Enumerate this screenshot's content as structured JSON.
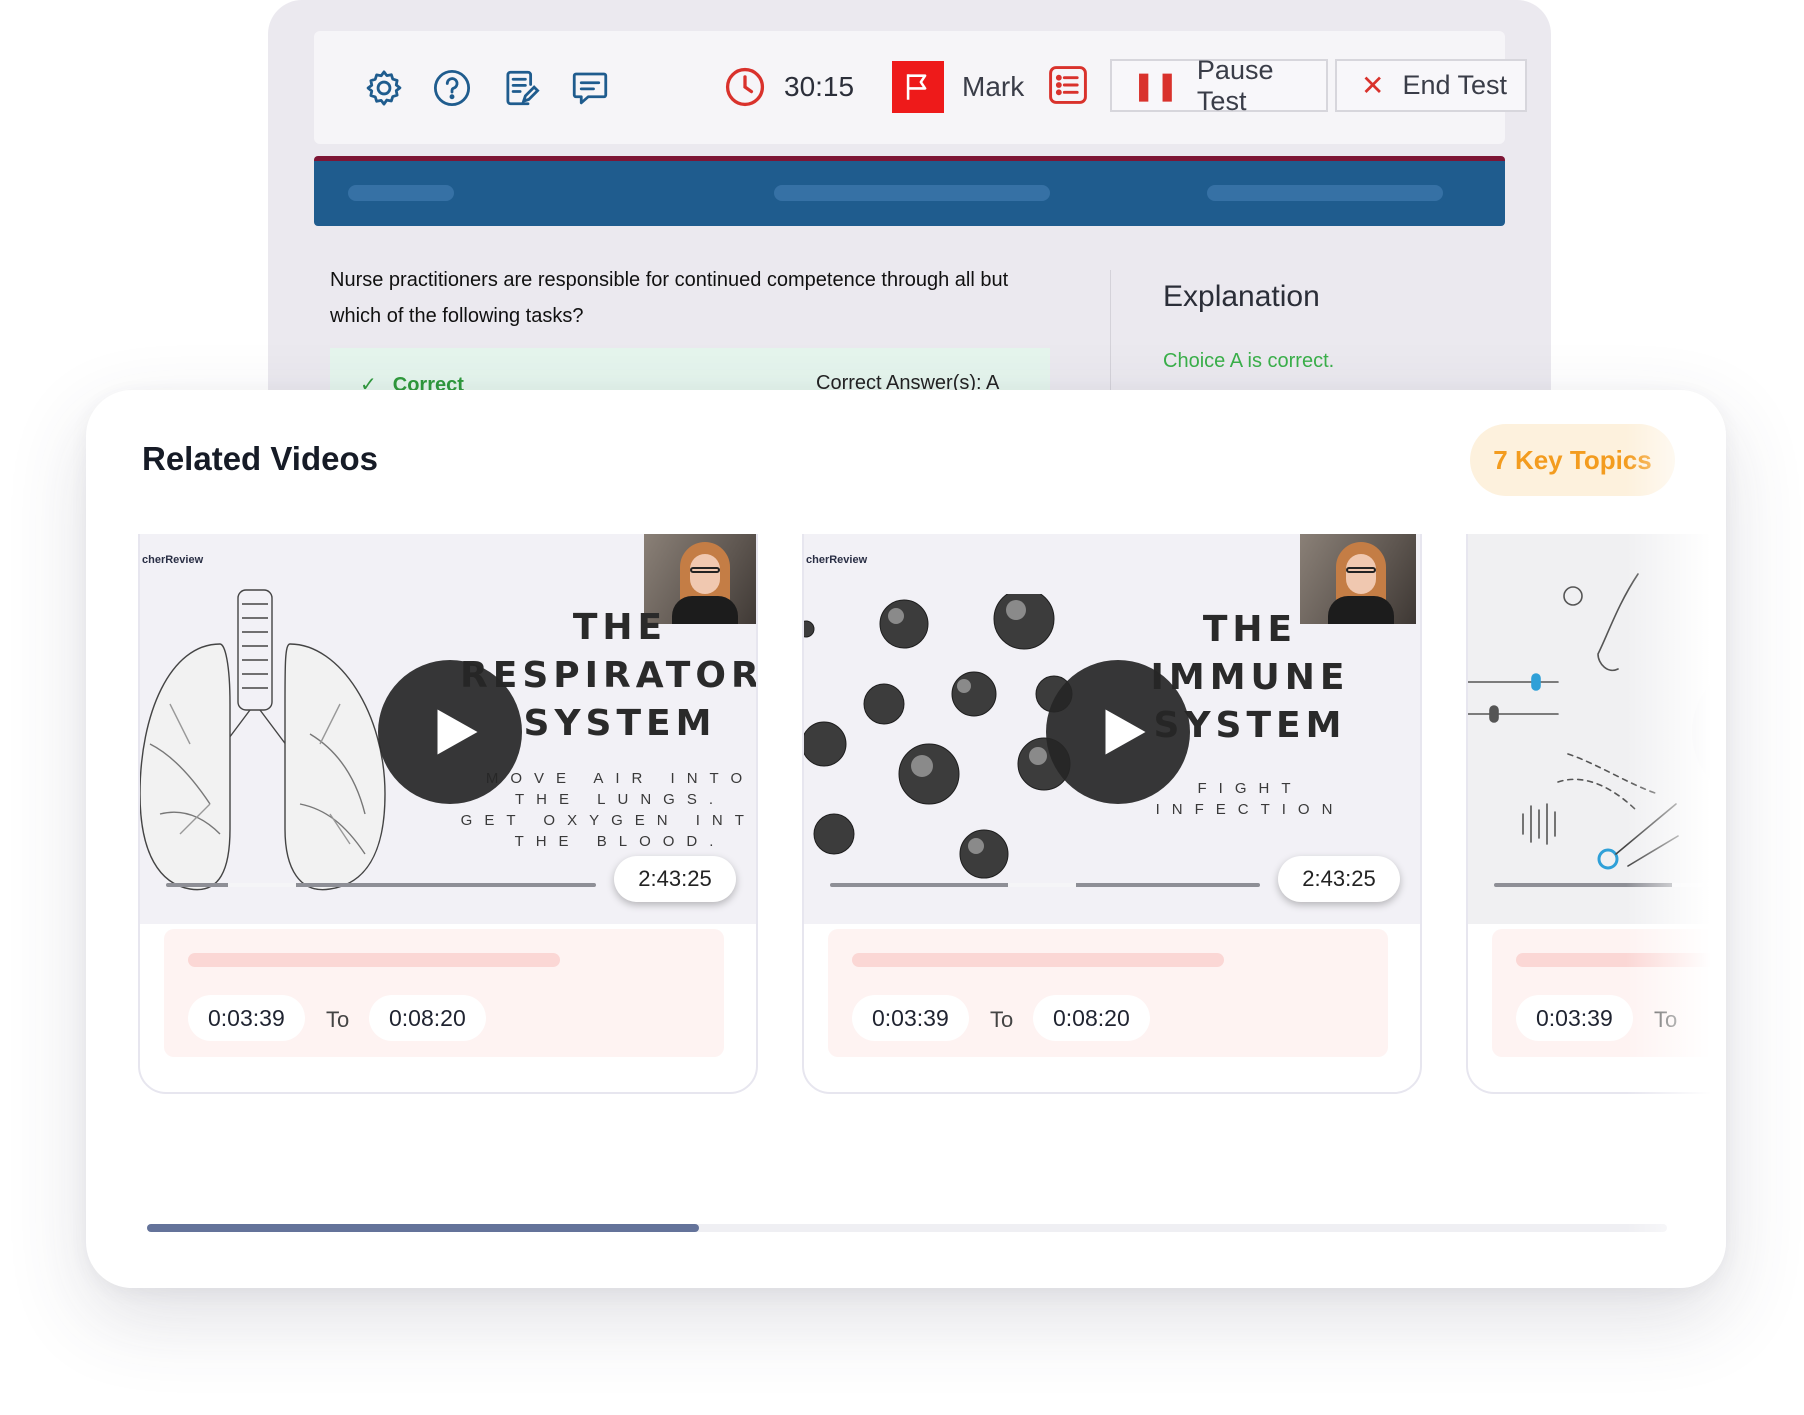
{
  "test": {
    "timer": "30:15",
    "mark_label": "Mark",
    "pause_label": "Pause Test",
    "end_label": "End Test",
    "question": "Nurse practitioners are responsible for continued competence through all but which of the following tasks?",
    "correct_label": "Correct",
    "correct_answer_label": "Correct Answer(s): A",
    "explanation_title": "Explanation",
    "explanation_text": "Choice A is correct.",
    "icons": [
      "gear-icon",
      "help-icon",
      "notes-icon",
      "feedback-icon",
      "clock-icon",
      "flag-icon",
      "list-icon",
      "pause-icon",
      "close-icon"
    ],
    "colors": {
      "header_blue": "#1f5c8e",
      "header_accent": "#7d1535",
      "flag_red": "#ee1a1a",
      "correct_green": "#2f9a3c"
    }
  },
  "related": {
    "title": "Related Videos",
    "key_topics": "7 Key Topics",
    "videos": [
      {
        "brand": "cherReview",
        "title": "THE\nRESPIRATORY\nSYSTEM",
        "subtitle": "MOVE AIR INTO\nTHE LUNGS.\nGET OXYGEN INTO\nTHE BLOOD.",
        "duration": "2:43:25",
        "start": "0:03:39",
        "to_label": "To",
        "end": "0:08:20"
      },
      {
        "brand": "cherReview",
        "title": "THE\nIMMUNE\nSYSTEM",
        "subtitle": "FIGHT\nINFECTION",
        "duration": "2:43:25",
        "start": "0:03:39",
        "to_label": "To",
        "end": "0:08:20"
      },
      {
        "start": "0:03:39",
        "to_label": "To"
      }
    ],
    "colors": {
      "key_topics_bg": "#fdf1dd",
      "key_topics_text": "#f39c1f",
      "scroll_thumb": "#64739a"
    }
  }
}
